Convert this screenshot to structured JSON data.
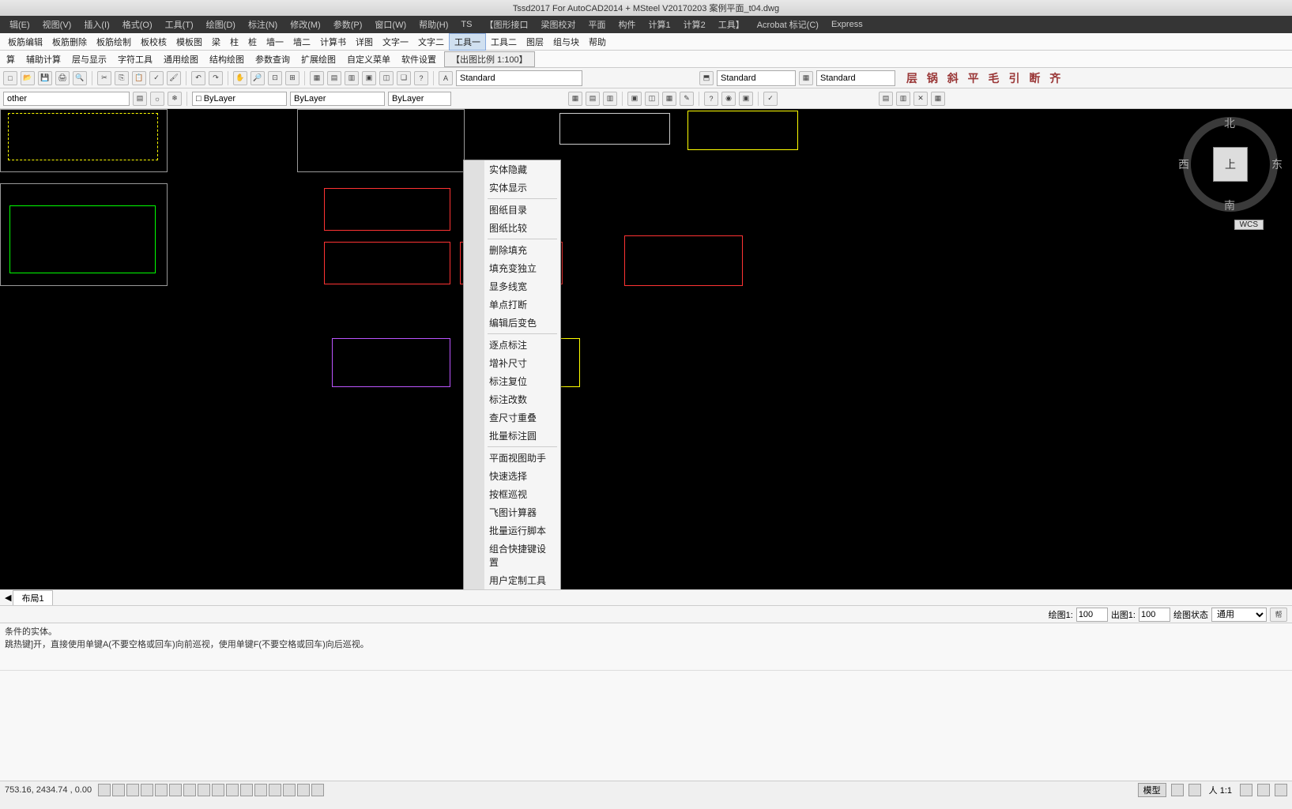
{
  "title": "Tssd2017 For AutoCAD2014 + MSteel V20170203    案例平面_t04.dwg",
  "menubar": {
    "items": [
      "辑(E)",
      "视图(V)",
      "插入(I)",
      "格式(O)",
      "工具(T)",
      "绘图(D)",
      "标注(N)",
      "修改(M)",
      "参数(P)",
      "窗口(W)",
      "帮助(H)",
      "TS",
      "【图形接口",
      "梁图校对",
      "平面",
      "构件",
      "计算1",
      "计算2",
      "工具】",
      "Acrobat 标记(C)",
      "Express"
    ]
  },
  "menubar2": {
    "items": [
      "板筋编辑",
      "板筋删除",
      "板筋绘制",
      "板校核",
      "模板图",
      "梁",
      "柱",
      "桩",
      "墙一",
      "墙二",
      "计算书",
      "详图",
      "文字一",
      "文字二",
      "工具一",
      "工具二",
      "图层",
      "组与块",
      "帮助"
    ],
    "activeIndex": 14
  },
  "secondary": {
    "items": [
      "算",
      "辅助计算",
      "层与显示",
      "字符工具",
      "通用绘图",
      "结构绘图",
      "参数查询",
      "扩展绘图",
      "自定义菜单",
      "软件设置"
    ],
    "chipLabel": "【出图比例 1:100】"
  },
  "toolbar1": {
    "combo1": "Standard",
    "combo2": "Standard",
    "combo3": "Standard",
    "rightGlyphs": "层 锅 斜 平 毛 引 断 齐"
  },
  "toolbar2": {
    "layerCombo": "other",
    "bylayer1": "□ ByLayer",
    "bylayer2": "ByLayer",
    "bylayer3": "ByLayer"
  },
  "dropdown": {
    "groups": [
      [
        "实体隐藏",
        "实体显示"
      ],
      [
        "图纸目录",
        "图纸比较"
      ],
      [
        "删除填充",
        "填充变独立",
        "显多线宽",
        "单点打断",
        "编辑后变色"
      ],
      [
        "逐点标注",
        "增补尺寸",
        "标注复位",
        "标注改数",
        "查尺寸重叠",
        "批量标注圆"
      ],
      [
        "平面视图助手",
        "快速选择",
        "按框巡视",
        "飞图计算器",
        "批量运行脚本",
        "组合快捷键设置",
        "用户定制工具"
      ]
    ]
  },
  "navcube": {
    "north": "北",
    "south": "南",
    "east": "东",
    "west": "西",
    "top": "上",
    "wcs": "WCS"
  },
  "tabs": {
    "layout": "布局1"
  },
  "footer": {
    "label1": "绘图1:",
    "val1": "100",
    "label2": "出图1:",
    "val2": "100",
    "label3": "绘图状态",
    "val3": "通用",
    "helpBtn": "帮"
  },
  "cmdlines": {
    "l1": "条件的实体。",
    "l2": "跳热键]开，直接使用单键A(不要空格或回车)向前巡视，使用单键F(不要空格或回车)向后巡视。"
  },
  "status": {
    "coords": "753.16, 2434.74 , 0.00",
    "rightLabels": {
      "model": "模型",
      "ratio": "人 1:1"
    }
  }
}
